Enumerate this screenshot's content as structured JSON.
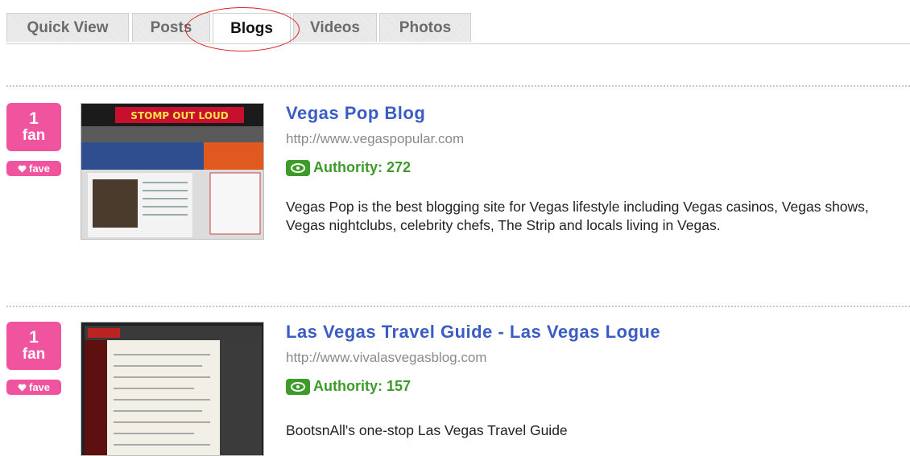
{
  "tabs": [
    {
      "label": "Quick View",
      "active": false
    },
    {
      "label": "Posts",
      "active": false
    },
    {
      "label": "Blogs",
      "active": true
    },
    {
      "label": "Videos",
      "active": false
    },
    {
      "label": "Photos",
      "active": false
    }
  ],
  "entries": [
    {
      "fan_count": "1",
      "fan_unit": "fan",
      "fave_label": "fave",
      "title": "Vegas Pop Blog",
      "url": "http://www.vegaspopular.com",
      "authority": "Authority: 272",
      "description": "Vegas Pop is the best blogging site for Vegas lifestyle including Vegas casinos, Vegas shows, Vegas nightclubs, celebrity chefs, The Strip and locals living in Vegas.",
      "thumb_banner": "STOMP OUT LOUD"
    },
    {
      "fan_count": "1",
      "fan_unit": "fan",
      "fave_label": "fave",
      "title": "Las Vegas Travel Guide - Las Vegas Logue",
      "url": "http://www.vivalasvegasblog.com",
      "authority": "Authority: 157",
      "description": "BootsnAll's one-stop Las Vegas Travel Guide"
    }
  ],
  "colors": {
    "badge_pink": "#f0549f",
    "title_blue": "#3b5cc4",
    "authority_green": "#3e9b2a",
    "highlight_circle": "#dd2222"
  },
  "icons": {
    "heart": "heart-icon",
    "authority": "authority-eye-icon"
  }
}
